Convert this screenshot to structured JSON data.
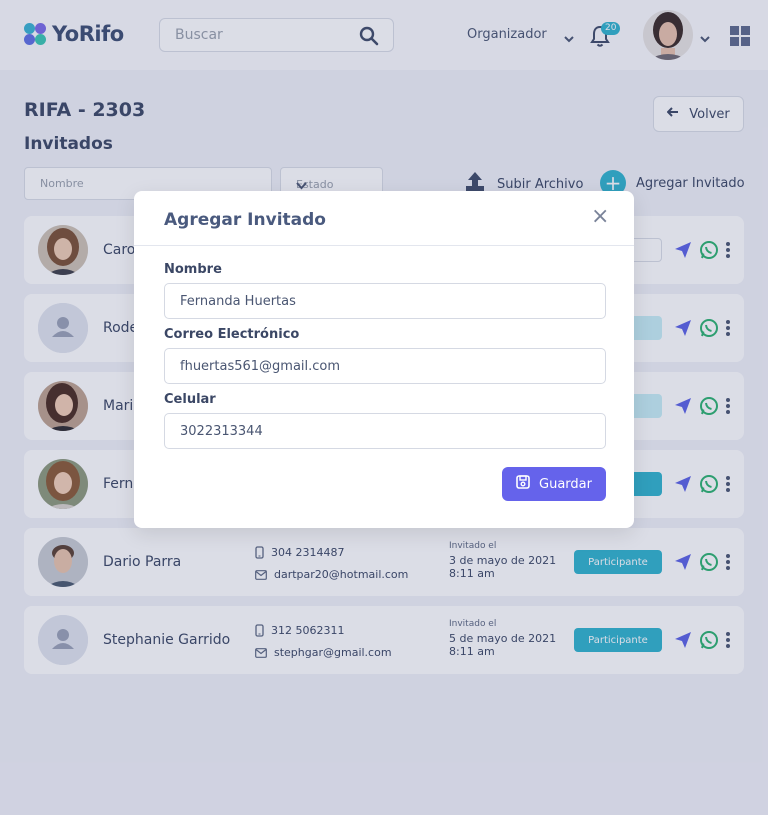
{
  "header": {
    "logo_text": "YoRifo",
    "search_placeholder": "Buscar",
    "role": "Organizador",
    "notifications_count": "20"
  },
  "page": {
    "title": "RIFA - 2303",
    "subtitle": "Invitados",
    "back_label": "Volver",
    "filter_name_placeholder": "Nombre",
    "filter_state_placeholder": "Estado",
    "upload_label": "Subir Archivo",
    "add_label": "Agregar Invitado"
  },
  "rows": [
    {
      "name": "Caro",
      "status": "",
      "status_style": "outline"
    },
    {
      "name": "Rode",
      "status": "o",
      "status_style": "light"
    },
    {
      "name": "Mari",
      "status": "o",
      "status_style": "light"
    },
    {
      "name": "Fern",
      "status": "nte",
      "status_style": "solid"
    },
    {
      "name": "Dario Parra",
      "phone": "304 2314487",
      "email": "dartpar20@hotmail.com",
      "invited_label": "Invitado el",
      "invited_date": "3 de mayo de 2021 8:11 am",
      "status": "Participante",
      "status_style": "solid"
    },
    {
      "name": "Stephanie Garrido",
      "phone": "312 5062311",
      "email": "stephgar@gmail.com",
      "invited_label": "Invitado el",
      "invited_date": "5 de mayo de 2021 8:11 am",
      "status": "Participante",
      "status_style": "solid"
    }
  ],
  "modal": {
    "title": "Agregar Invitado",
    "close_symbol": "×",
    "name_label": "Nombre",
    "name_value": "Fernanda Huertas",
    "email_label": "Correo Electrónico",
    "email_value": "fhuertas561@gmail.com",
    "phone_label": "Celular",
    "phone_value": "3022313344",
    "save_label": "Guardar"
  },
  "colors": {
    "accent": "#6563eb",
    "teal": "#2fb4cd",
    "whatsapp": "#2bb36f"
  }
}
